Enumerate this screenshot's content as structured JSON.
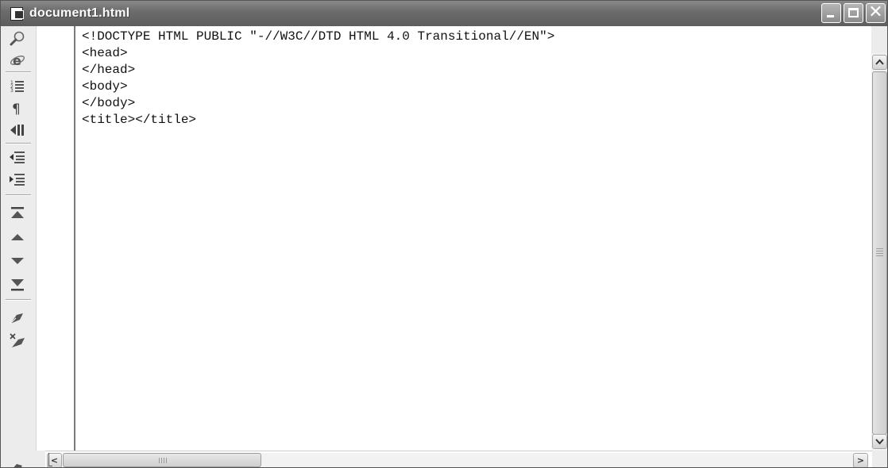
{
  "window": {
    "title": "document1.html",
    "controls": {
      "minimize_icon": "minimize-icon",
      "maximize_icon": "maximize-icon",
      "close_glyph": "✕"
    }
  },
  "toolbar": {
    "tools": [
      {
        "name": "find-icon"
      },
      {
        "name": "browser-preview-icon"
      },
      {
        "name": "line-numbers-icon"
      },
      {
        "name": "paragraph-marks-icon"
      },
      {
        "name": "word-wrap-icon"
      },
      {
        "name": "outdent-icon"
      },
      {
        "name": "indent-icon"
      },
      {
        "name": "go-to-top-icon"
      },
      {
        "name": "previous-icon"
      },
      {
        "name": "next-icon"
      },
      {
        "name": "go-to-bottom-icon"
      },
      {
        "name": "bookmark-icon"
      },
      {
        "name": "clear-bookmark-icon"
      }
    ]
  },
  "editor": {
    "lines": [
      "<!DOCTYPE HTML PUBLIC \"-//W3C//DTD HTML 4.0 Transitional//EN\">",
      "<head>",
      "</head>",
      "<body>",
      "</body>",
      "<title></title>"
    ]
  },
  "scrollbars": {
    "up_arrow": "⌃",
    "down_arrow": "⌄",
    "left_arrow": "<",
    "right_arrow": ">"
  }
}
